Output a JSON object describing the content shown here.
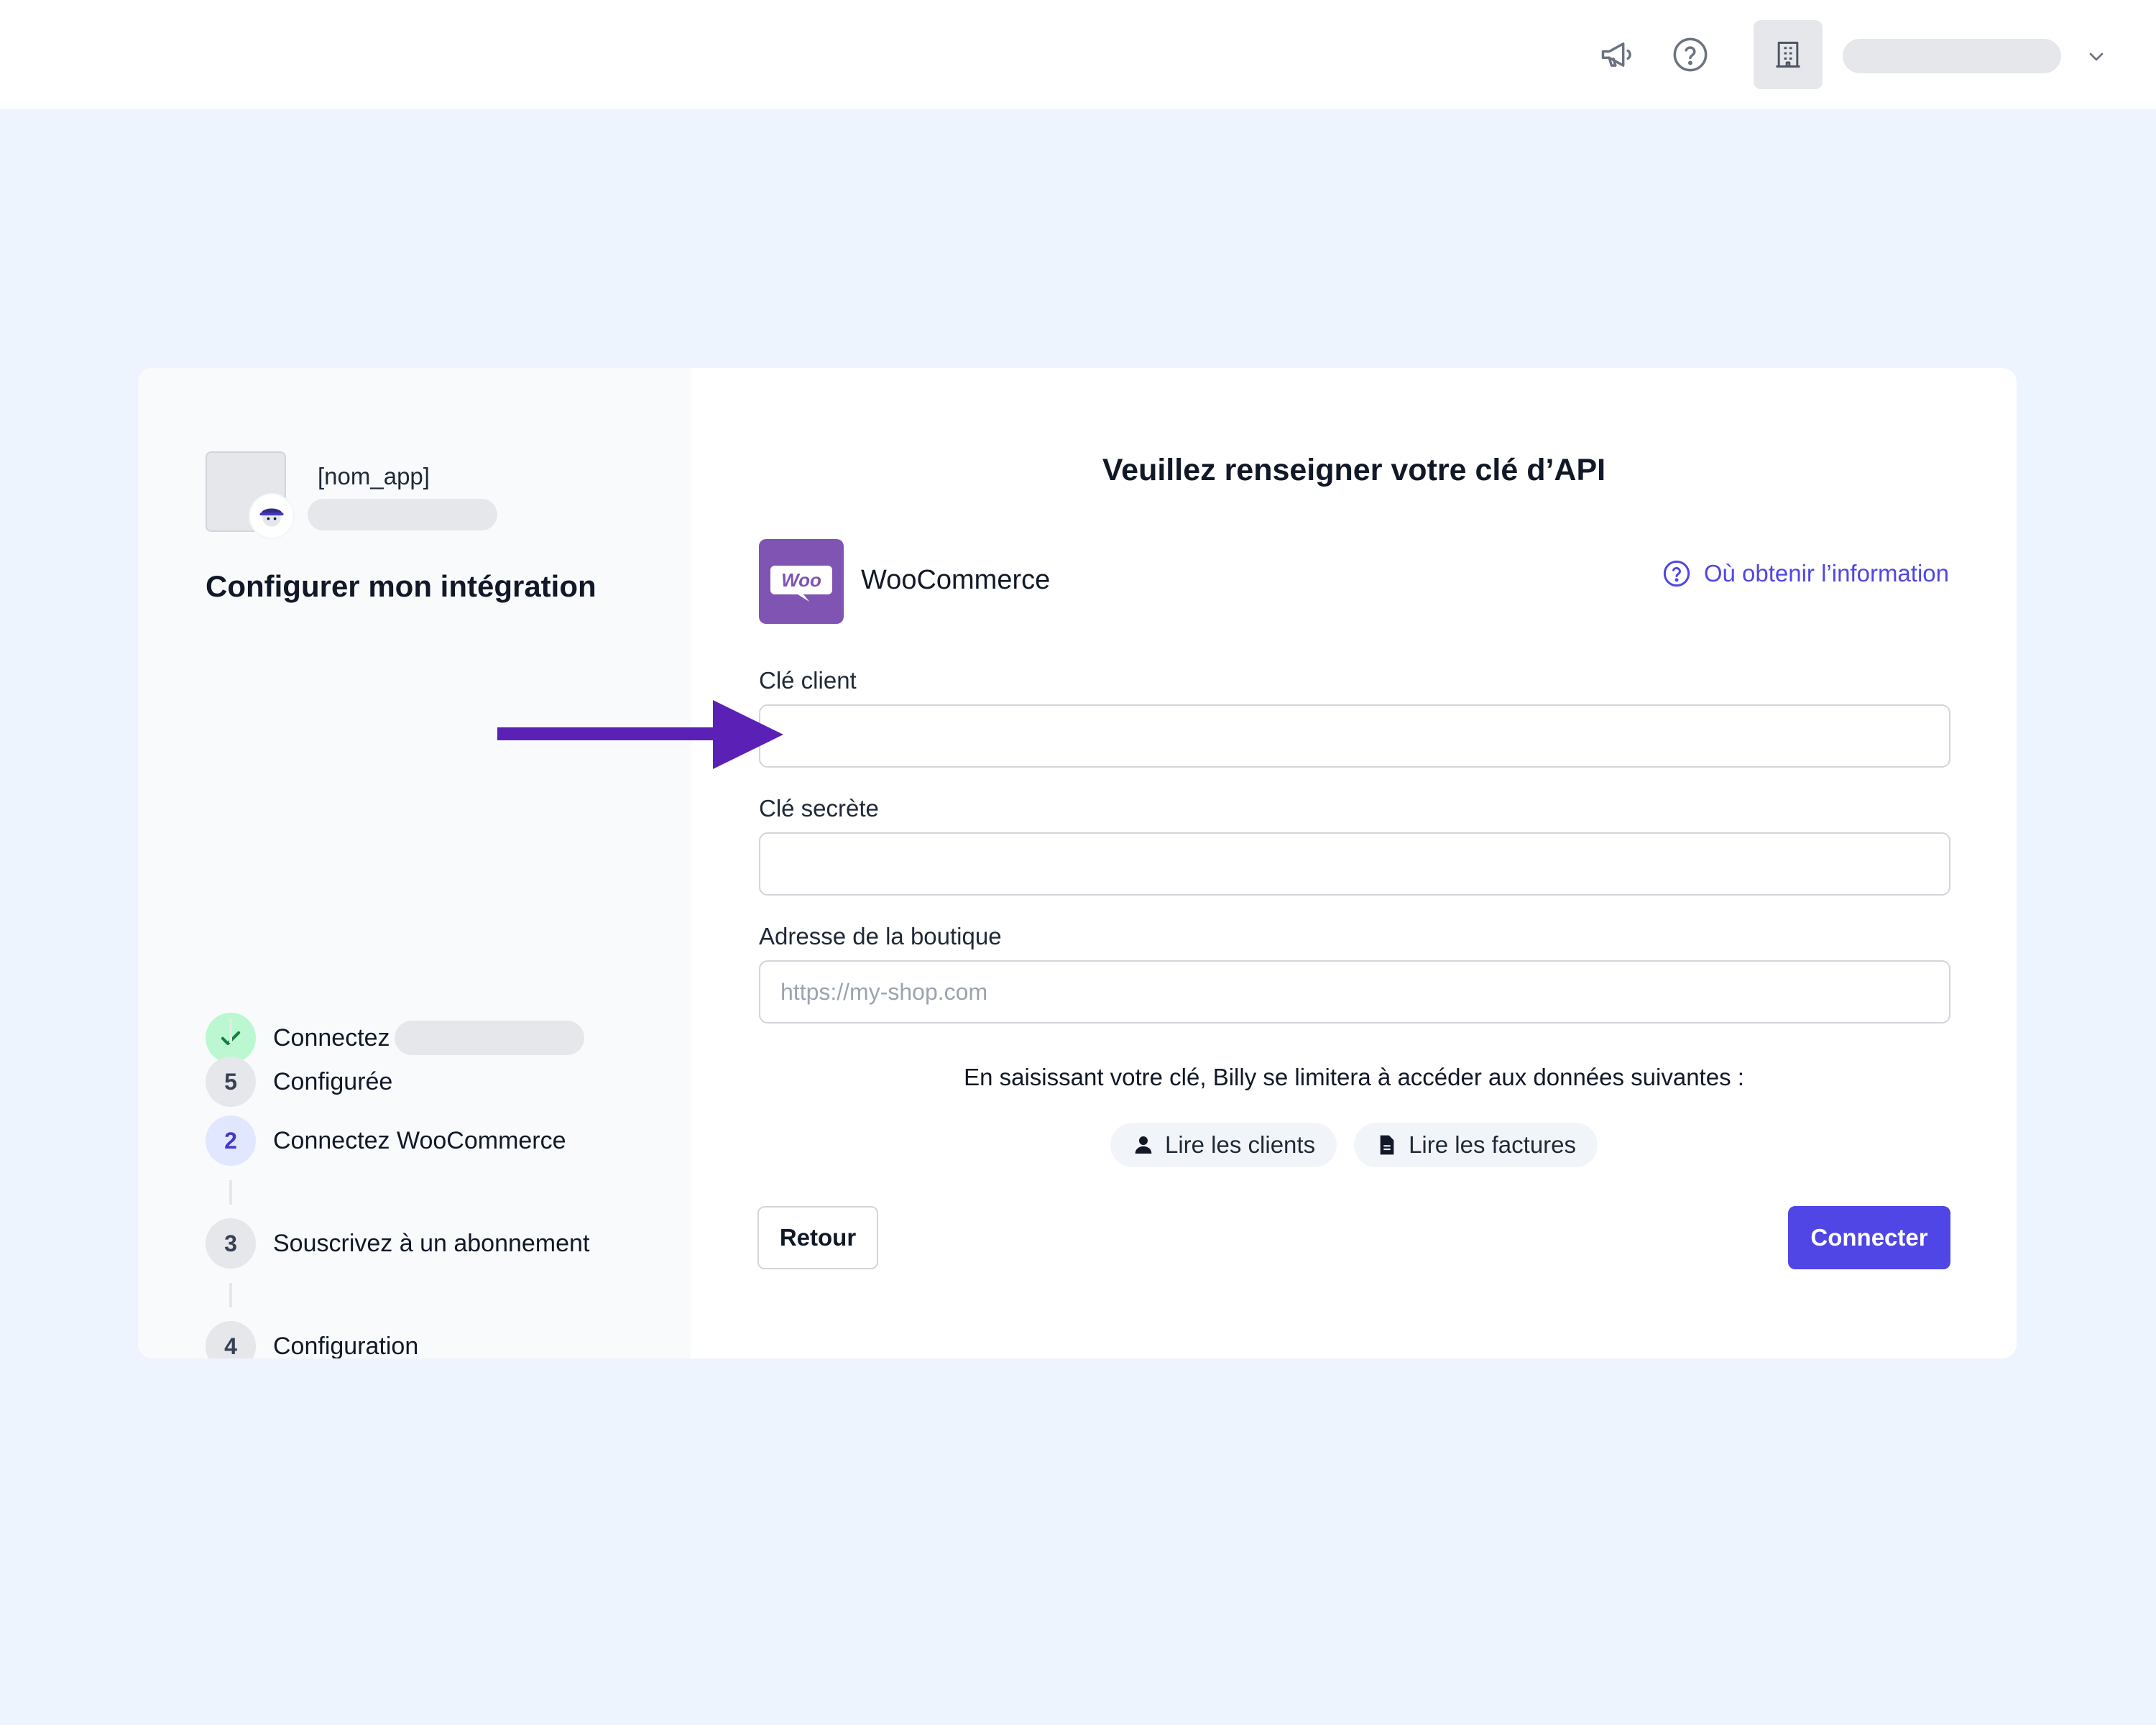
{
  "header": {
    "icons": [
      "megaphone-icon",
      "help-icon",
      "building-icon",
      "chevron-down-icon"
    ]
  },
  "sidebar": {
    "app_name": "[nom_app]",
    "title": "Configurer mon intégration",
    "steps": [
      {
        "number": "",
        "label": "Connectez",
        "status": "done"
      },
      {
        "number": "2",
        "label": "Connectez WooCommerce",
        "status": "active"
      },
      {
        "number": "3",
        "label": "Souscrivez à un abonnement",
        "status": "pending"
      },
      {
        "number": "4",
        "label": "Configuration",
        "status": "pending"
      },
      {
        "number": "5",
        "label": "Configurée",
        "status": "pending"
      }
    ]
  },
  "main": {
    "title": "Veuillez renseigner votre clé d’API",
    "provider": {
      "logo_text": "Woo",
      "name": "WooCommerce",
      "color": "#7f54b3"
    },
    "info_link": "Où obtenir l’information",
    "fields": {
      "client_key": {
        "label": "Clé client",
        "value": "",
        "placeholder": ""
      },
      "secret_key": {
        "label": "Clé secrète",
        "value": "",
        "placeholder": ""
      },
      "shop_address": {
        "label": "Adresse de la boutique",
        "value": "",
        "placeholder": "https://my-shop.com"
      }
    },
    "notice": "En saisissant votre clé, Billy se limitera à accéder aux données suivantes :",
    "permissions": [
      {
        "icon": "user-icon",
        "label": "Lire les clients"
      },
      {
        "icon": "document-icon",
        "label": "Lire les factures"
      }
    ],
    "buttons": {
      "back": "Retour",
      "connect": "Connecter"
    }
  },
  "colors": {
    "accent": "#4f46e5",
    "background": "#eef4fe",
    "success": "#bbf7d0",
    "arrow": "#5b21b6"
  }
}
